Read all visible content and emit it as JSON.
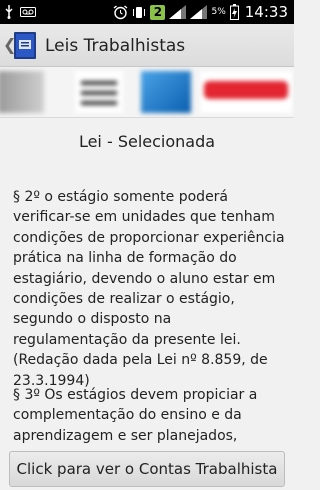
{
  "status_bar": {
    "badge": "2",
    "battery": "5%",
    "time": "14:33"
  },
  "action_bar": {
    "title": "Leis Trabalhistas",
    "back": "❮"
  },
  "content": {
    "selected_title": "Lei - Selecionada",
    "paragraph_1": "§ 2º o estágio somente poderá verificar-se em unidades que tenham condições de proporcionar experiência prática na linha de formação do estagiário, devendo o aluno estar em condições de realizar o estágio, segundo o disposto na regulamentação da presente lei.(Redação dada pela Lei nº 8.859, de 23.3.1994)",
    "paragraph_2": "§ 3º Os estágios devem propiciar a complementação do ensino e da aprendizagem e ser planejados,"
  },
  "bottom_button": {
    "label": "Click para ver o Contas Trabalhista"
  },
  "colors": {
    "background": "#f1f1f1",
    "status_bar": "#000000",
    "badge": "#8bc34a",
    "action_bar": "#e2e2e2"
  }
}
